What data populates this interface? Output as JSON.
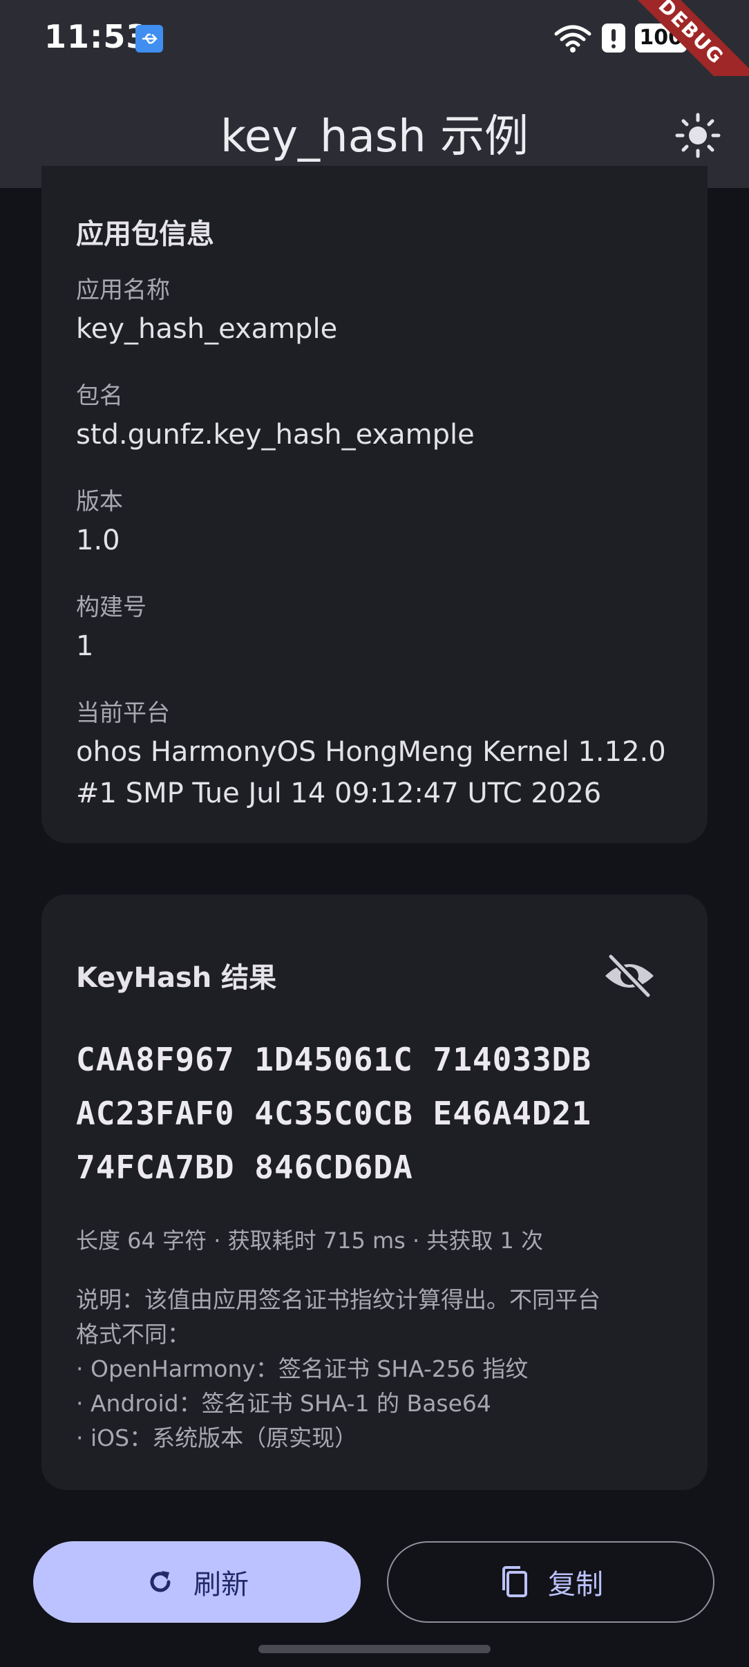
{
  "status_bar": {
    "time": "11:53",
    "battery": "100",
    "debug_label": "DEBUG",
    "icons": [
      "usb-icon",
      "wifi-icon",
      "alert-icon",
      "battery-icon"
    ]
  },
  "app_bar": {
    "title": "key_hash 示例",
    "theme_icon": "sun-icon"
  },
  "package_info": {
    "title": "应用包信息",
    "fields": [
      {
        "label": "应用名称",
        "value": "key_hash_example"
      },
      {
        "label": "包名",
        "value": "std.gunfz.key_hash_example"
      },
      {
        "label": "版本",
        "value": "1.0"
      },
      {
        "label": "构建号",
        "value": "1"
      },
      {
        "label": "当前平台",
        "value_lines": [
          "ohos HarmonyOS HongMeng Kernel 1.12.0",
          "#1 SMP Tue Jul 14 09:12:47 UTC 2026"
        ]
      }
    ]
  },
  "keyhash": {
    "title": "KeyHash 结果",
    "visibility_icon": "eye-off-icon",
    "lines": [
      "CAA8F967 1D45061C 714033DB",
      "AC23FAF0 4C35C0CB E46A4D21",
      "74FCA7BD 846CD6DA"
    ],
    "stats": "长度 64 字符 · 获取耗时 715 ms · 共获取 1 次",
    "note_lines": [
      "说明：该值由应用签名证书指纹计算得出。不同平台",
      "格式不同：",
      "· OpenHarmony：签名证书 SHA-256 指纹",
      "· Android：签名证书 SHA-1 的 Base64",
      "· iOS：系统版本（原实现）"
    ]
  },
  "actions": {
    "refresh_label": "刷新",
    "refresh_icon": "refresh-icon",
    "copy_label": "复制",
    "copy_icon": "copy-icon"
  },
  "colors": {
    "background": "#121318",
    "surface": "#1e1f25",
    "bar": "#2c2d34",
    "primary": "#bcc2ff",
    "debug": "#a02727"
  }
}
